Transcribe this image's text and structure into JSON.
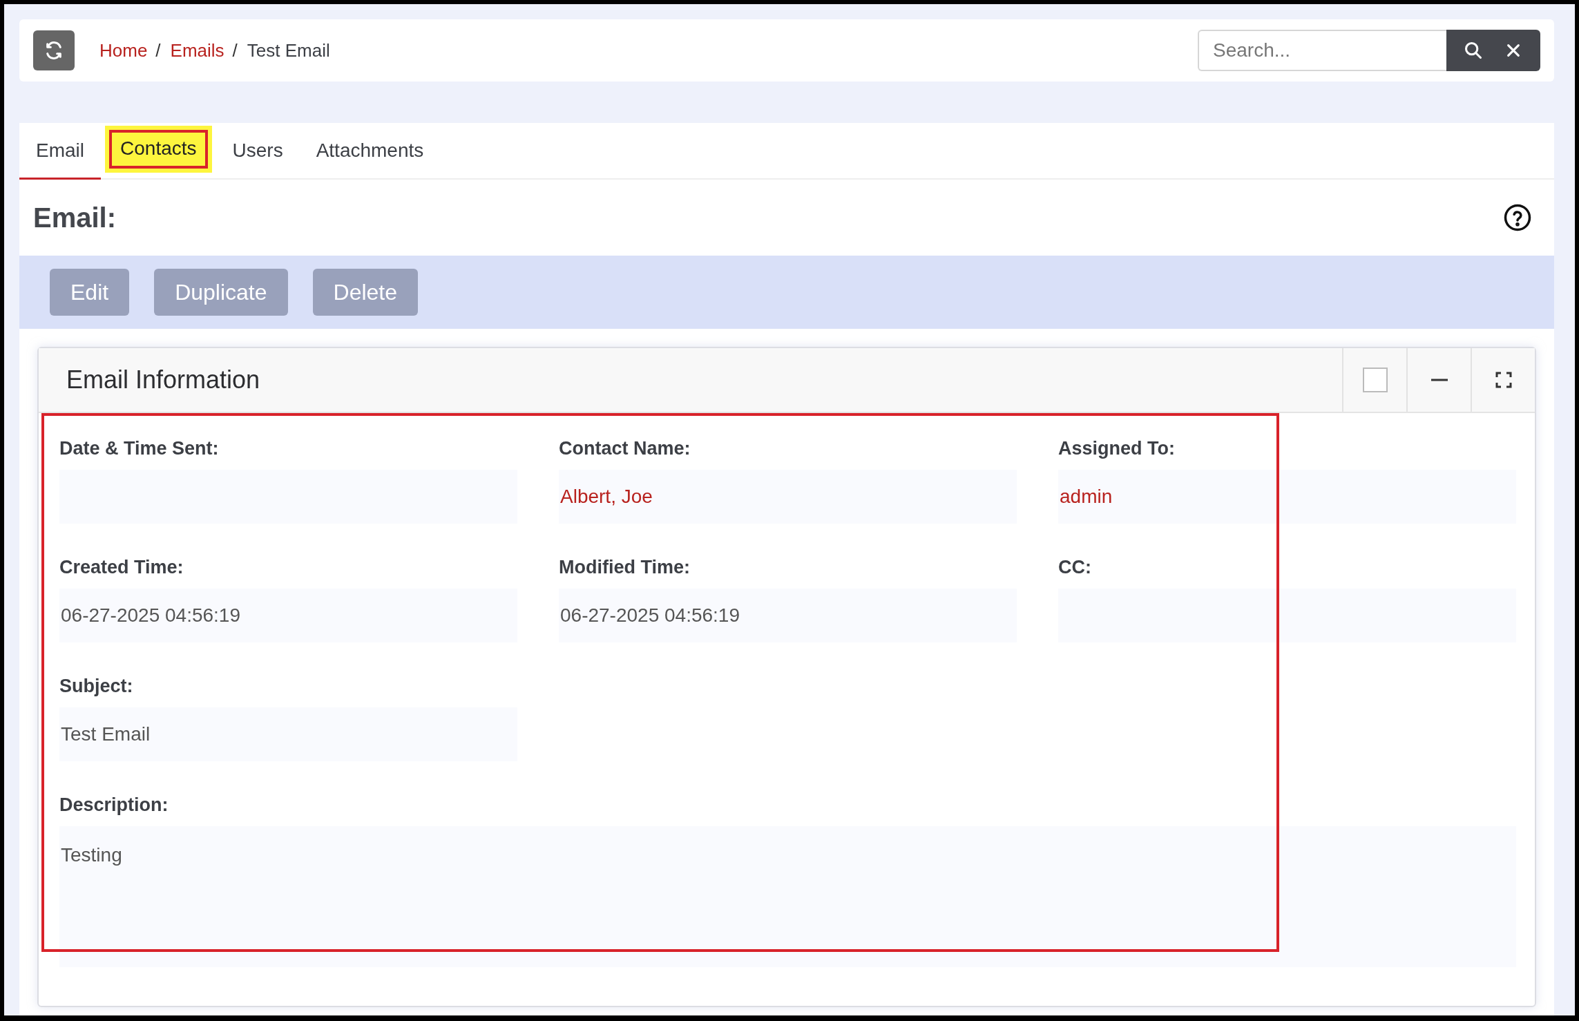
{
  "header": {
    "breadcrumb": [
      {
        "label": "Home",
        "link": true
      },
      {
        "label": "Emails",
        "link": true
      },
      {
        "label": "Test Email",
        "link": false
      }
    ],
    "separator": "/",
    "search": {
      "placeholder": "Search..."
    }
  },
  "tabs": [
    {
      "label": "Email",
      "selected": true,
      "highlighted": false
    },
    {
      "label": "Contacts",
      "selected": false,
      "highlighted": true
    },
    {
      "label": "Users",
      "selected": false,
      "highlighted": false
    },
    {
      "label": "Attachments",
      "selected": false,
      "highlighted": false
    }
  ],
  "heading": "Email:",
  "actions": [
    "Edit",
    "Duplicate",
    "Delete"
  ],
  "panel": {
    "title": "Email Information",
    "checked": false,
    "fields_outlined": true,
    "fields": [
      {
        "kind": "field",
        "label": "Date & Time Sent:"
      },
      {
        "kind": "field",
        "label": "Contact Name:",
        "value": "Albert, Joe",
        "link": true
      },
      {
        "kind": "field",
        "label": "Assigned To:",
        "value": "admin",
        "link": true
      },
      {
        "kind": "field",
        "label": "Created Time:",
        "value": "06-27-2025 04:56:19",
        "link": false
      },
      {
        "kind": "field",
        "label": "Modified Time:",
        "value": "06-27-2025 04:56:19",
        "link": false
      },
      {
        "kind": "field",
        "label": "CC:"
      },
      {
        "kind": "field",
        "label": "Subject:",
        "value": "Test Email",
        "link": false
      },
      {
        "kind": "wide",
        "label": "Description:",
        "value": "Testing",
        "link": false
      }
    ]
  }
}
